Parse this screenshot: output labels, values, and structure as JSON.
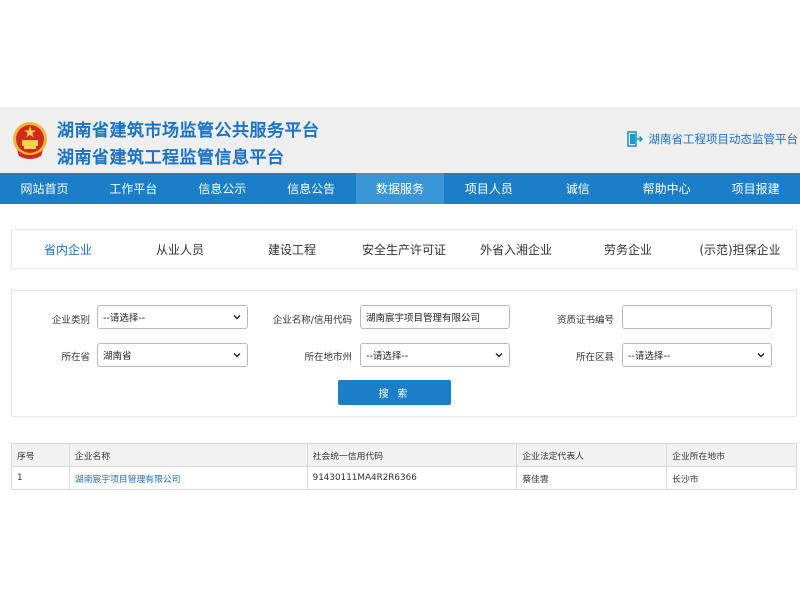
{
  "header": {
    "title_line1": "湖南省建筑市场监管公共服务平台",
    "title_line2": "湖南省建筑工程监管信息平台",
    "dynamic_link": "湖南省工程项目动态监管平台"
  },
  "nav": {
    "items": [
      "网站首页",
      "工作平台",
      "信息公示",
      "信息公告",
      "数据服务",
      "项目人员",
      "诚信",
      "帮助中心",
      "项目报建"
    ],
    "active": "数据服务"
  },
  "subtabs": {
    "items": [
      "省内企业",
      "从业人员",
      "建设工程",
      "安全生产许可证",
      "外省入湘企业",
      "劳务企业",
      "(示范)担保企业"
    ],
    "active": "省内企业"
  },
  "search": {
    "enterprise_type_label": "企业类别",
    "enterprise_type_value": "--请选择--",
    "name_label": "企业名称/信用代码",
    "name_value": "湖南宸宇项目管理有限公司",
    "cert_label": "资质证书编号",
    "cert_value": "",
    "province_label": "所在省",
    "province_value": "湖南省",
    "city_label": "所在地市州",
    "city_value": "--请选择--",
    "county_label": "所在区县",
    "county_value": "--请选择--",
    "button_label": "搜 索"
  },
  "table": {
    "headers": [
      "序号",
      "企业名称",
      "社会统一信用代码",
      "企业法定代表人",
      "企业所在地市"
    ],
    "rows": [
      [
        "1",
        "湖南宸宇项目管理有限公司",
        "91430111MA4R2R6366",
        "蔡佳雲",
        "长沙市"
      ]
    ]
  },
  "colors": {
    "primary": "#1a7fc8",
    "nav_active": "#3896d6",
    "link": "#1a73c6",
    "header_bg": "#efefef"
  }
}
